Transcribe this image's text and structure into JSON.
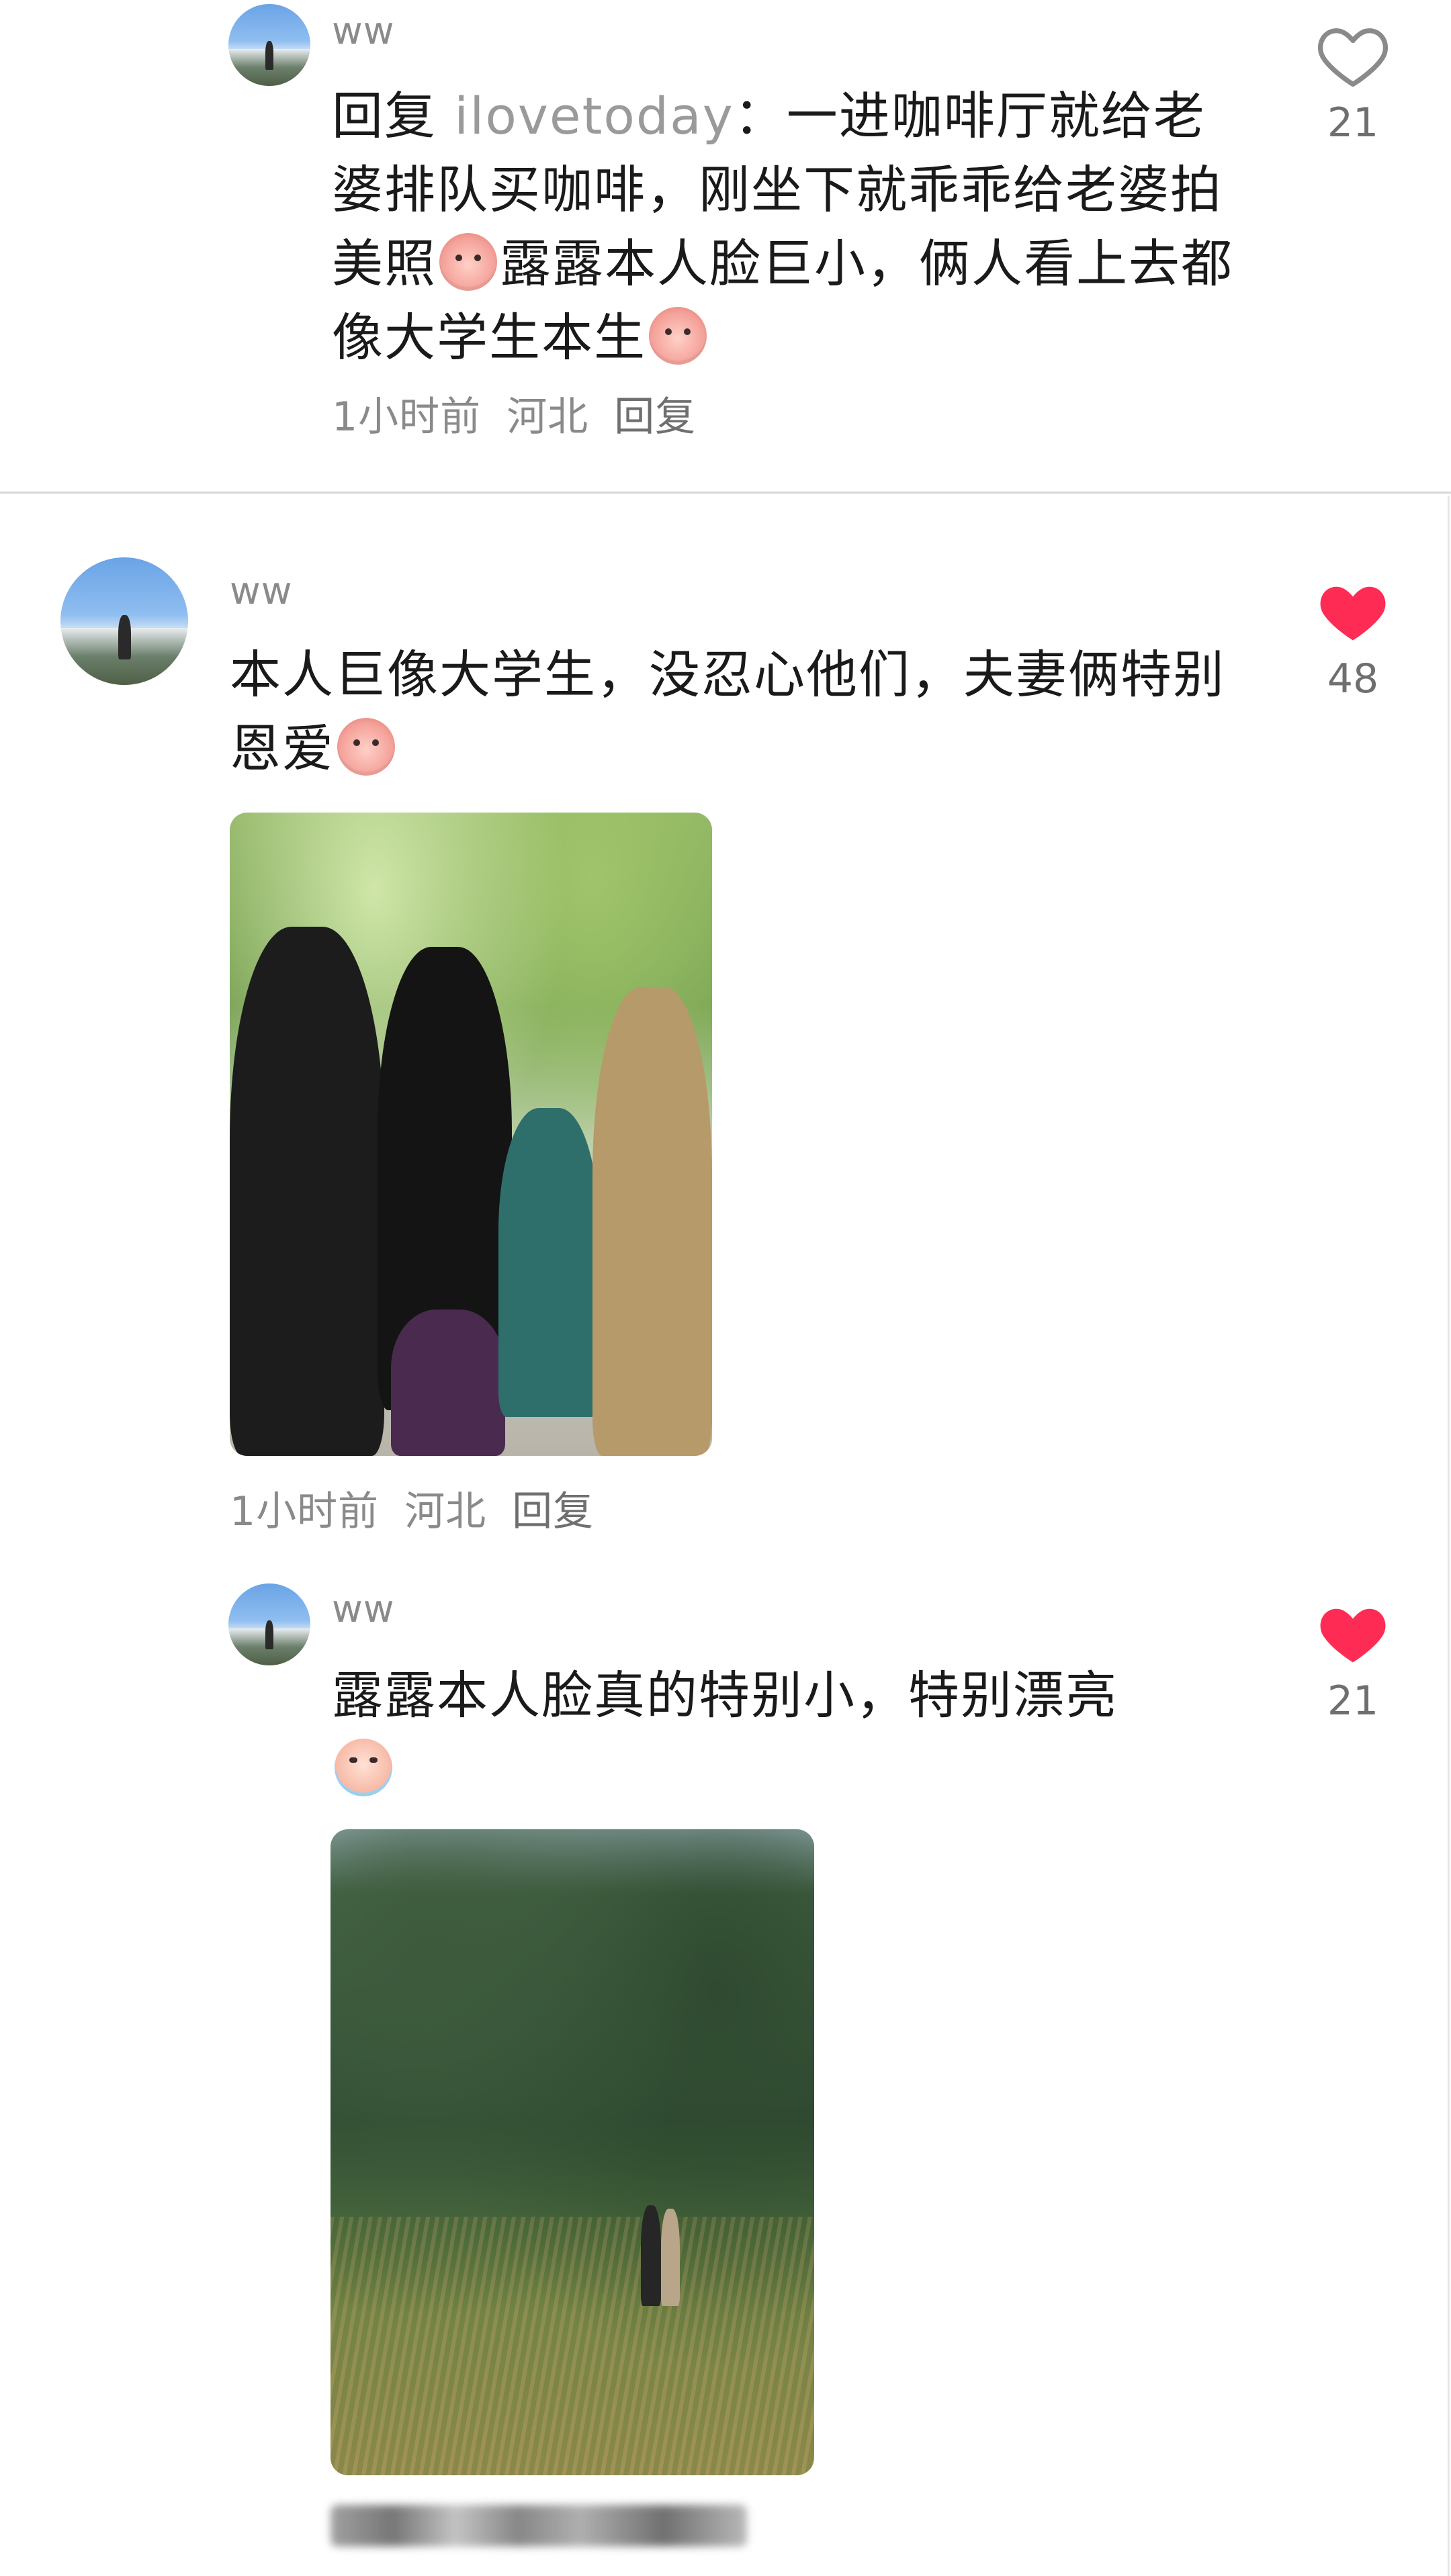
{
  "comments": [
    {
      "id": "c1",
      "username": "ww",
      "reply_prefix": "回复",
      "reply_to": "ilovetoday",
      "reply_sep": "：",
      "text_part1": "一进咖啡厅就给老婆排队买咖啡，刚坐下就乖乖给老婆拍美照",
      "emoji1": "pink-face-emoji",
      "text_part2": "露露本人脸巨小，俩人看上去都像大学生本生",
      "emoji2": "pink-face-emoji",
      "time": "1小时前",
      "location": "河北",
      "reply_label": "回复",
      "likes": "21",
      "liked": false
    },
    {
      "id": "c2",
      "username": "ww",
      "text_part1": "本人巨像大学生，没忍心他们，夫妻俩特别恩爱",
      "emoji1": "pink-face-emoji",
      "time": "1小时前",
      "location": "河北",
      "reply_label": "回复",
      "likes": "48",
      "liked": true
    },
    {
      "id": "c3",
      "username": "ww",
      "text_part1": "露露本人脸真的特别小，特别漂亮",
      "emoji1": "crying-face-emoji",
      "likes": "21",
      "liked": true
    }
  ],
  "colors": {
    "like_active": "#fe2c55",
    "like_inactive": "#8a8a8a",
    "meta_gray": "#8a8a8a",
    "reply_name_gray": "#9a9a9a"
  },
  "icons": {
    "heart_outline": "heart-outline-icon",
    "heart_filled": "heart-filled-icon"
  }
}
